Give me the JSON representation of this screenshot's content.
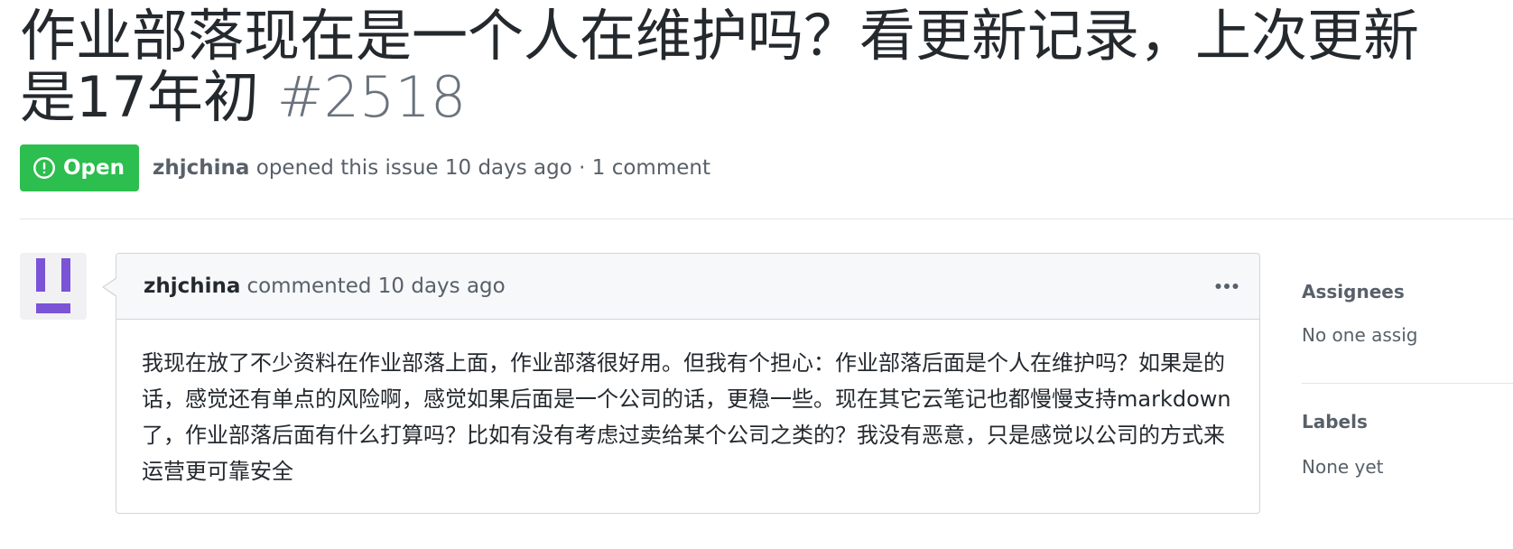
{
  "issue": {
    "title": "作业部落现在是一个人在维护吗？看更新记录，上次更新是17年初",
    "number": "#2518",
    "state": "Open",
    "author": "zhjchina",
    "opened_text": "opened this issue 10 days ago · 1 comment"
  },
  "comment": {
    "author": "zhjchina",
    "action": "commented 10 days ago",
    "body": "我现在放了不少资料在作业部落上面，作业部落很好用。但我有个担心：作业部落后面是个人在维护吗？如果是的话，感觉还有单点的风险啊，感觉如果后面是一个公司的话，更稳一些。现在其它云笔记也都慢慢支持markdown了，作业部落后面有什么打算吗？比如有没有考虑过卖给某个公司之类的？我没有恶意，只是感觉以公司的方式来运营更可靠安全"
  },
  "sidebar": {
    "assignees_label": "Assignees",
    "assignees_value": "No one assig",
    "labels_label": "Labels",
    "labels_value": "None yet"
  },
  "colors": {
    "open_green": "#2cbe4e",
    "avatar_purple": "#7a53d6",
    "muted_text": "#586069"
  },
  "icons": [
    "issue-opened-icon",
    "kebab-horizontal-icon"
  ]
}
